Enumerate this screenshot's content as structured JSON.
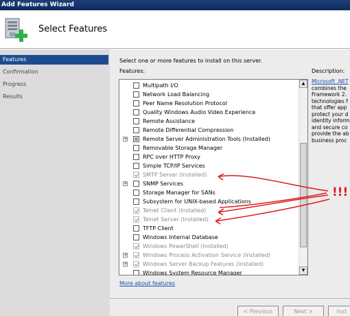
{
  "window": {
    "title": "Add Features Wizard"
  },
  "header": {
    "title": "Select Features"
  },
  "nav": {
    "items": [
      {
        "label": "Features",
        "active": true
      },
      {
        "label": "Confirmation",
        "active": false
      },
      {
        "label": "Progress",
        "active": false
      },
      {
        "label": "Results",
        "active": false
      }
    ]
  },
  "content": {
    "instruction": "Select one or more features to install on this server.",
    "features_label": "Features:",
    "description_label": "Description:",
    "more_link": "More about features"
  },
  "features": [
    {
      "label": "Multipath I/O",
      "state": "unchecked",
      "expandable": false,
      "disabled": false
    },
    {
      "label": "Network Load Balancing",
      "state": "unchecked",
      "expandable": false,
      "disabled": false
    },
    {
      "label": "Peer Name Resolution Protocol",
      "state": "unchecked",
      "expandable": false,
      "disabled": false
    },
    {
      "label": "Quality Windows Audio Video Experience",
      "state": "unchecked",
      "expandable": false,
      "disabled": false
    },
    {
      "label": "Remote Assistance",
      "state": "unchecked",
      "expandable": false,
      "disabled": false
    },
    {
      "label": "Remote Differential Compression",
      "state": "unchecked",
      "expandable": false,
      "disabled": false
    },
    {
      "label": "Remote Server Administration Tools (Installed)",
      "state": "partial",
      "expandable": true,
      "disabled": false
    },
    {
      "label": "Removable Storage Manager",
      "state": "unchecked",
      "expandable": false,
      "disabled": false
    },
    {
      "label": "RPC over HTTP Proxy",
      "state": "unchecked",
      "expandable": false,
      "disabled": false
    },
    {
      "label": "Simple TCP/IP Services",
      "state": "unchecked",
      "expandable": false,
      "disabled": false
    },
    {
      "label": "SMTP Server (Installed)",
      "state": "checked",
      "expandable": false,
      "disabled": true
    },
    {
      "label": "SNMP Services",
      "state": "unchecked",
      "expandable": true,
      "disabled": false
    },
    {
      "label": "Storage Manager for SANs",
      "state": "unchecked",
      "expandable": false,
      "disabled": false
    },
    {
      "label": "Subsystem for UNIX-based Applications",
      "state": "unchecked",
      "expandable": false,
      "disabled": false
    },
    {
      "label": "Telnet Client (Installed)",
      "state": "checked",
      "expandable": false,
      "disabled": true
    },
    {
      "label": "Telnet Server (Installed)",
      "state": "checked",
      "expandable": false,
      "disabled": true
    },
    {
      "label": "TFTP Client",
      "state": "unchecked",
      "expandable": false,
      "disabled": false
    },
    {
      "label": "Windows Internal Database",
      "state": "unchecked",
      "expandable": false,
      "disabled": false
    },
    {
      "label": "Windows PowerShell (Installed)",
      "state": "checked",
      "expandable": false,
      "disabled": true
    },
    {
      "label": "Windows Process Activation Service (Installed)",
      "state": "checked",
      "expandable": true,
      "disabled": true
    },
    {
      "label": "Windows Server Backup Features (Installed)",
      "state": "checked",
      "expandable": true,
      "disabled": true
    },
    {
      "label": "Windows System Resource Manager",
      "state": "unchecked",
      "expandable": false,
      "disabled": false
    }
  ],
  "description": {
    "link": "Microsoft .NET",
    "lines": [
      "combines the",
      "Framework 2.",
      "technologies f",
      "that offer app",
      "protect your d",
      "identity inform",
      "and secure co",
      "provide the ab",
      "business proc"
    ]
  },
  "footer": {
    "previous": "< Previous",
    "next": "Next >",
    "install": "Inst"
  },
  "annotation": {
    "text": "!!!",
    "color": "#e01a1a"
  }
}
